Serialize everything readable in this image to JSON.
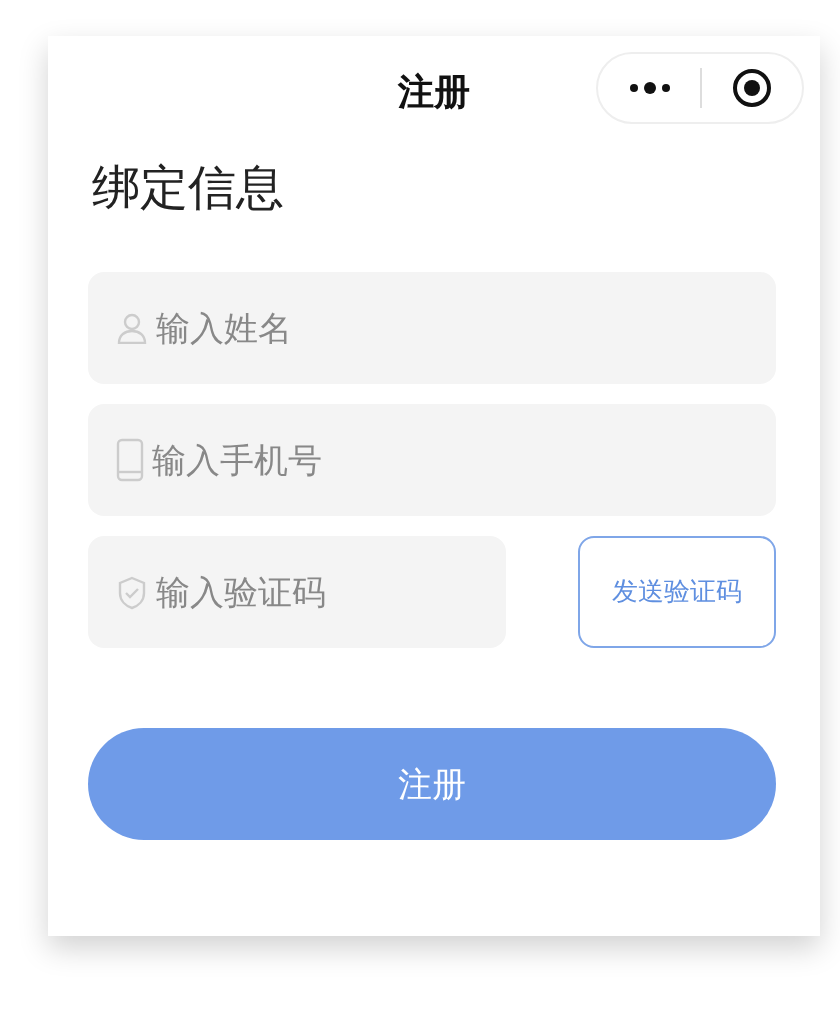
{
  "navbar": {
    "title": "注册"
  },
  "heading": "绑定信息",
  "fields": [
    {
      "kind": "name",
      "placeholder": "输入姓名"
    },
    {
      "kind": "phone",
      "placeholder": "输入手机号"
    },
    {
      "kind": "code",
      "placeholder": "输入验证码"
    }
  ],
  "send_code_button": "发送验证码",
  "submit_button": "注册"
}
